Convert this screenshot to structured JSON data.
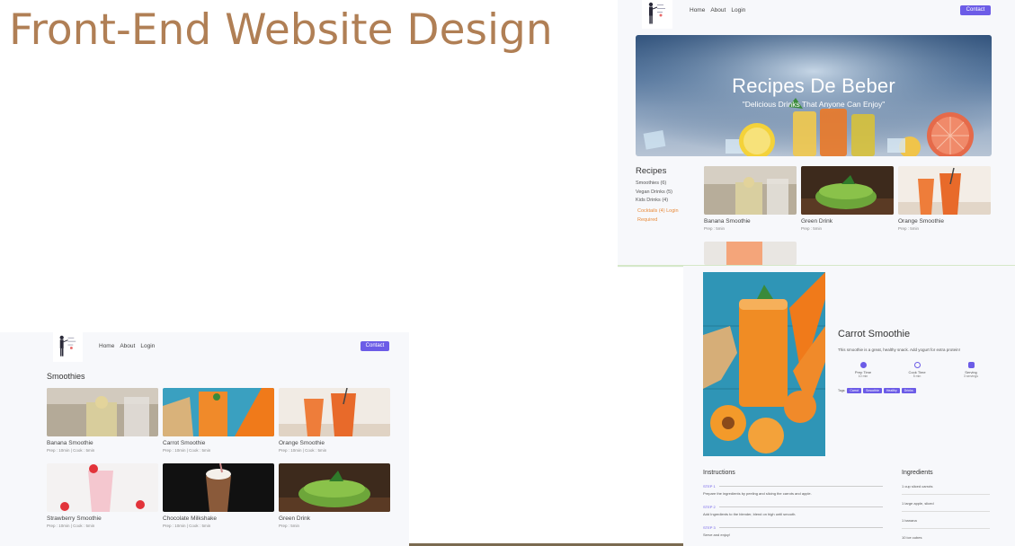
{
  "title": "Front-End Website Design",
  "colors": {
    "title": "#b07f55",
    "accent": "#6c5ce7",
    "warning": "#e88a3a"
  },
  "home": {
    "nav": [
      "Home",
      "About",
      "Login"
    ],
    "contact": "Contact",
    "hero_title": "Recipes De Beber",
    "hero_subtitle": "\"Delicious Drinks That Anyone Can Enjoy\"",
    "sidebar_title": "Recipes",
    "categories": [
      "Smoothies (6)",
      "Vegan Drinks (5)",
      "Kids Drinks (4)"
    ],
    "locked_category": "Cocktails (4) Login Required",
    "cards": [
      {
        "title": "Banana Smoothie",
        "meta": "Prep : 5min"
      },
      {
        "title": "Green Drink",
        "meta": "Prep : 5min"
      },
      {
        "title": "Orange Smoothie",
        "meta": "Prep : 5min"
      }
    ]
  },
  "listing": {
    "nav": [
      "Home",
      "About",
      "Login"
    ],
    "contact": "Contact",
    "heading": "Smoothies",
    "cards": [
      {
        "title": "Banana Smoothie",
        "meta": "Prep : 10min | Cook : 5min"
      },
      {
        "title": "Carrot Smoothie",
        "meta": "Prep : 10min | Cook : 5min"
      },
      {
        "title": "Orange Smoothie",
        "meta": "Prep : 10min | Cook : 5min"
      },
      {
        "title": "Strawberry Smoothie",
        "meta": "Prep : 10min | Cook : 5min"
      },
      {
        "title": "Chocolate Milkshake",
        "meta": "Prep : 10min | Cook : 5min"
      },
      {
        "title": "Green Drink",
        "meta": "Prep : 5min"
      }
    ]
  },
  "detail": {
    "title": "Carrot Smoothie",
    "description": "This smoothie is a great, healthy snack. Add yogurt for extra protein!",
    "stats": [
      {
        "label": "Prep Time",
        "value": "10 min"
      },
      {
        "label": "Cook Time",
        "value": "5 min"
      },
      {
        "label": "Serving",
        "value": "3 servings"
      }
    ],
    "tags_label": "Tags:",
    "tags": [
      "Carrot",
      "Smoothie",
      "Healthy",
      "Drinks"
    ],
    "instructions_title": "Instructions",
    "steps": [
      {
        "label": "STEP 1",
        "text": "Prepare the ingredients by peeling and slicing the carrots and apple."
      },
      {
        "label": "STEP 2",
        "text": "Add Ingredients to the blender, blend on high until smooth."
      },
      {
        "label": "STEP 3",
        "text": "Serve and enjoy!"
      }
    ],
    "ingredients_title": "Ingredients",
    "ingredients": [
      "1 cup sliced carrots",
      "1 large apple, sliced",
      "1 banana",
      "10 ice cubes"
    ]
  }
}
